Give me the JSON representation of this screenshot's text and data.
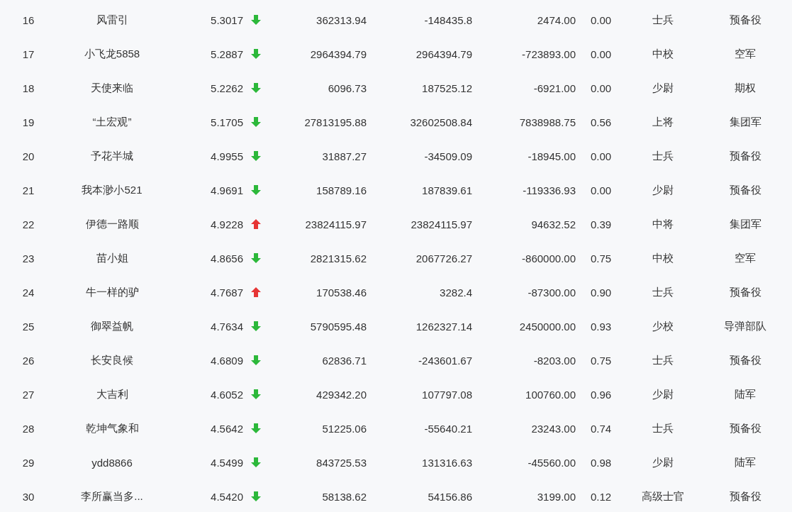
{
  "table": {
    "rows": [
      {
        "column_1": "16",
        "column_2": "风雷引",
        "column_3": "5.3017",
        "kind": "down",
        "column_4": "362313.94",
        "column_5": "-148435.8",
        "column_6": "2474.00",
        "column_7": "0.00",
        "column_8": "士兵",
        "column_9": "预备役"
      },
      {
        "column_1": "17",
        "column_2": "小飞龙5858",
        "column_3": "5.2887",
        "kind": "down",
        "column_4": "2964394.79",
        "column_5": "2964394.79",
        "column_6": "-723893.00",
        "column_7": "0.00",
        "column_8": "中校",
        "column_9": "空军"
      },
      {
        "column_1": "18",
        "column_2": "天使来临",
        "column_3": "5.2262",
        "kind": "down",
        "column_4": "6096.73",
        "column_5": "187525.12",
        "column_6": "-6921.00",
        "column_7": "0.00",
        "column_8": "少尉",
        "column_9": "期权"
      },
      {
        "column_1": "19",
        "column_2": "“土宏观”",
        "column_3": "5.1705",
        "kind": "down",
        "column_4": "27813195.88",
        "column_5": "32602508.84",
        "column_6": "7838988.75",
        "column_7": "0.56",
        "column_8": "上将",
        "column_9": "集团军"
      },
      {
        "column_1": "20",
        "column_2": "予花半城",
        "column_3": "4.9955",
        "kind": "down",
        "column_4": "31887.27",
        "column_5": "-34509.09",
        "column_6": "-18945.00",
        "column_7": "0.00",
        "column_8": "士兵",
        "column_9": "预备役"
      },
      {
        "column_1": "21",
        "column_2": "我本渺小521",
        "column_3": "4.9691",
        "kind": "down",
        "column_4": "158789.16",
        "column_5": "187839.61",
        "column_6": "-119336.93",
        "column_7": "0.00",
        "column_8": "少尉",
        "column_9": "预备役"
      },
      {
        "column_1": "22",
        "column_2": "伊德一路顺",
        "column_3": "4.9228",
        "kind": "up",
        "column_4": "23824115.97",
        "column_5": "23824115.97",
        "column_6": "94632.52",
        "column_7": "0.39",
        "column_8": "中将",
        "column_9": "集团军"
      },
      {
        "column_1": "23",
        "column_2": "苗小姐",
        "column_3": "4.8656",
        "kind": "down",
        "column_4": "2821315.62",
        "column_5": "2067726.27",
        "column_6": "-860000.00",
        "column_7": "0.75",
        "column_8": "中校",
        "column_9": "空军"
      },
      {
        "column_1": "24",
        "column_2": "牛一样的驴",
        "column_3": "4.7687",
        "kind": "up",
        "column_4": "170538.46",
        "column_5": "3282.4",
        "column_6": "-87300.00",
        "column_7": "0.90",
        "column_8": "士兵",
        "column_9": "预备役"
      },
      {
        "column_1": "25",
        "column_2": "御翠益帆",
        "column_3": "4.7634",
        "kind": "down",
        "column_4": "5790595.48",
        "column_5": "1262327.14",
        "column_6": "2450000.00",
        "column_7": "0.93",
        "column_8": "少校",
        "column_9": "导弹部队"
      },
      {
        "column_1": "26",
        "column_2": "长安良候",
        "column_3": "4.6809",
        "kind": "down",
        "column_4": "62836.71",
        "column_5": "-243601.67",
        "column_6": "-8203.00",
        "column_7": "0.75",
        "column_8": "士兵",
        "column_9": "预备役"
      },
      {
        "column_1": "27",
        "column_2": "大吉利",
        "column_3": "4.6052",
        "kind": "down",
        "column_4": "429342.20",
        "column_5": "107797.08",
        "column_6": "100760.00",
        "column_7": "0.96",
        "column_8": "少尉",
        "column_9": "陆军"
      },
      {
        "column_1": "28",
        "column_2": "乾坤气象和",
        "column_3": "4.5642",
        "kind": "down",
        "column_4": "51225.06",
        "column_5": "-55640.21",
        "column_6": "23243.00",
        "column_7": "0.74",
        "column_8": "士兵",
        "column_9": "预备役"
      },
      {
        "column_1": "29",
        "column_2": "ydd8866",
        "column_3": "4.5499",
        "kind": "down",
        "column_4": "843725.53",
        "column_5": "131316.63",
        "column_6": "-45560.00",
        "column_7": "0.98",
        "column_8": "少尉",
        "column_9": "陆军"
      },
      {
        "column_1": "30",
        "column_2": "李所赢当多...",
        "column_3": "4.5420",
        "kind": "down",
        "column_4": "58138.62",
        "column_5": "54156.86",
        "column_6": "3199.00",
        "column_7": "0.12",
        "column_8": "高级士官",
        "column_9": "预备役"
      }
    ]
  }
}
